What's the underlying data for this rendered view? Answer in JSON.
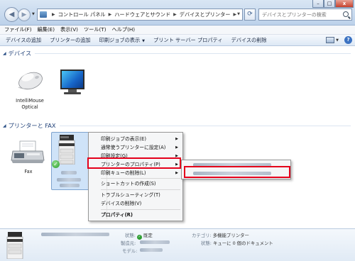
{
  "window": {
    "minimize": "–",
    "maximize": "□",
    "close": "x"
  },
  "address": {
    "crumbs": [
      "コントロール パネル",
      "ハードウェアとサウンド",
      "デバイスとプリンター"
    ],
    "search_placeholder": "デバイスとプリンターの検索"
  },
  "menubar": [
    "ファイル(F)",
    "編集(E)",
    "表示(V)",
    "ツール(T)",
    "ヘルプ(H)"
  ],
  "commandbar": [
    "デバイスの追加",
    "プリンターの追加",
    "印刷ジョブの表示",
    "プリント サーバー プロパティ",
    "デバイスの削除"
  ],
  "groups": {
    "devices_header": "デバイス",
    "printers_header": "プリンターと FAX"
  },
  "devices": [
    {
      "label": "IntelliMouse\nOptical",
      "icon": "mouse-icon"
    },
    {
      "label": "",
      "icon": "monitor-icon"
    }
  ],
  "printers": [
    {
      "label": "Fax",
      "icon": "fax-icon"
    },
    {
      "label": "",
      "icon": "printer-icon",
      "default": true
    }
  ],
  "context_menu": {
    "items": [
      "印刷ジョブの表示(E)",
      "通常使うプリンターに設定(A)",
      "印刷設定(G)",
      "プリンターのプロパティ(P)",
      "印刷キューの削除(L)",
      "ショートカットの作成(S)",
      "トラブルシューティング(T)",
      "デバイスの削除(V)",
      "プロパティ(R)"
    ]
  },
  "details": {
    "status_label": "状態:",
    "status_value": "既定",
    "maker_label": "製造元:",
    "model_label": "モデル:",
    "category_label": "カテゴリ:",
    "category_value": "多機能プリンター",
    "state_label": "状態:",
    "state_value": "キューに 0 個のドキュメント"
  },
  "colors": {
    "highlight_box": "#e4001b",
    "header_text": "#1e3f77",
    "selection": "#cfe3f8"
  }
}
